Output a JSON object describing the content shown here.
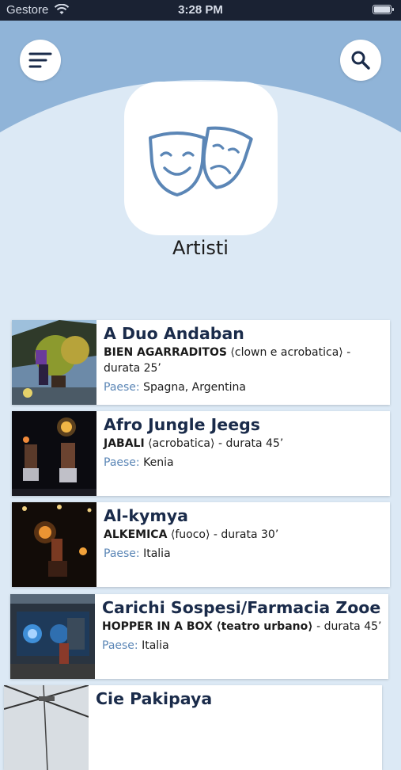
{
  "status_bar": {
    "carrier": "Gestore",
    "time": "3:28 PM"
  },
  "header": {
    "title": "Artisti",
    "logo_icon": "theater-masks-icon",
    "menu_icon": "sort-menu-icon",
    "search_icon": "search-icon"
  },
  "colors": {
    "header_bg": "#90b4d8",
    "page_bg": "#dce9f5",
    "accent_blue": "#5b86b6",
    "name_color": "#1a2b4a",
    "status_bar_bg": "#1a2233"
  },
  "country_label": "Paese:",
  "artists": [
    {
      "name": "A Duo Andaban",
      "show": "BIEN AGARRADITOS",
      "genre": "⟨clown e acrobatica⟩",
      "duration": "- durata 25’",
      "country": "Spagna, Argentina"
    },
    {
      "name": "Afro Jungle Jeegs",
      "show": "JABALI",
      "genre": "⟨acrobatica⟩",
      "duration": "- durata 45’",
      "country": "Kenia"
    },
    {
      "name": "Al-kymya",
      "show": "ALKEMICA",
      "genre": "⟨fuoco⟩",
      "duration": "- durata 30’",
      "country": "Italia"
    },
    {
      "name": "Carichi Sospesi/Farmacia Zooe",
      "show": "HOPPER IN A BOX",
      "genre": "⟨teatro urbano⟩",
      "duration": "- durata 45’",
      "country": "Italia"
    },
    {
      "name": "Cie Pakipaya"
    }
  ]
}
